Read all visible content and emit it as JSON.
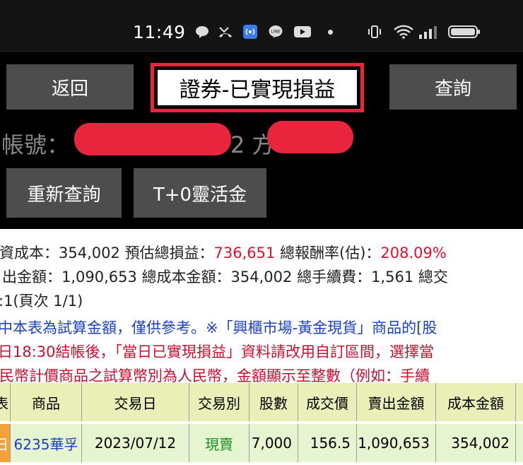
{
  "status_bar": {
    "time": "11:49",
    "icons": [
      "chat-bubble-icon",
      "missed-call-icon",
      "nfc-icon",
      "line-app-icon",
      "youtube-icon",
      "dot-icon",
      "vibrate-icon",
      "wifi-icon",
      "signal-icon",
      "battery-icon"
    ]
  },
  "header": {
    "back_label": "返回",
    "title": "證券-已實現損益",
    "query_label": "查詢",
    "account_label": "帳號：",
    "account_mid": "2 方",
    "requery_label": "重新查詢",
    "t0_label": "T+0靈活金",
    "accent_color": "#e8253c"
  },
  "summary": {
    "line1_a": "資成本：354,002  預估總損益：",
    "line1_profit": "736,651",
    "line1_b": "  總報酬率(估)：",
    "line1_rate": "208.09%",
    "line2": "出金額：1,090,653  總成本金額：354,002  總手續費：1,561  總交",
    "line3": ":1(頁次 1/1)",
    "note1": "中本表為試算金額，僅供參考。※「興櫃市場-黃金現貨」商品的[股",
    "note2": "日18:30結帳後，「當日已實現損益」資料請改用自訂區間，選擇當",
    "note3": "民幣計價商品之試算幣別為人民幣，金額顯示至整數（例如：手續"
  },
  "table": {
    "headers": [
      "表",
      "商品",
      "交易日",
      "交易別",
      "股數",
      "成交價",
      "賣出金額",
      "成本金額"
    ],
    "rows": [
      {
        "mark": "日",
        "product": "6235華孚",
        "date": "2023/07/12",
        "type": "現賣",
        "shares": "7,000",
        "price": "156.5",
        "sell_amount": "1,090,653",
        "cost_amount": "354,002"
      }
    ]
  }
}
